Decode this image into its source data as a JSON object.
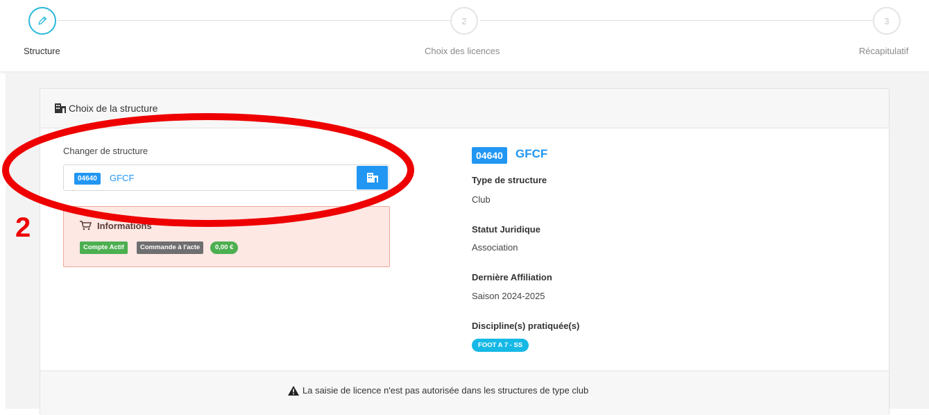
{
  "stepper": {
    "steps": [
      {
        "number": "",
        "label": "Structure",
        "active": true
      },
      {
        "number": "2",
        "label": "Choix des licences",
        "active": false
      },
      {
        "number": "3",
        "label": "Récapitulatif",
        "active": false
      }
    ]
  },
  "card": {
    "title": "Choix de la structure",
    "change_label": "Changer de structure",
    "input": {
      "code": "04640",
      "name": "GFCF"
    },
    "info": {
      "title": "Informations",
      "tags": {
        "account": "Compte Actif",
        "order": "Commande à l'acte",
        "amount": "0,00 €"
      }
    },
    "details": {
      "code": "04640",
      "name": "GFCF",
      "type_label": "Type de structure",
      "type_value": "Club",
      "status_label": "Statut Juridique",
      "status_value": "Association",
      "affiliation_label": "Dernière Affiliation",
      "affiliation_value": "Saison 2024-2025",
      "discipline_label": "Discipline(s) pratiquée(s)",
      "discipline_value": "FOOT A 7 - SS"
    },
    "footer_message": "La saisie de licence n'est pas autorisée dans les structures de type club"
  },
  "annotation": {
    "number": "2"
  },
  "colors": {
    "accent": "#2196f3",
    "stepper_active": "#29b8d9",
    "success": "#4caf50",
    "annotation": "#ee0000"
  }
}
